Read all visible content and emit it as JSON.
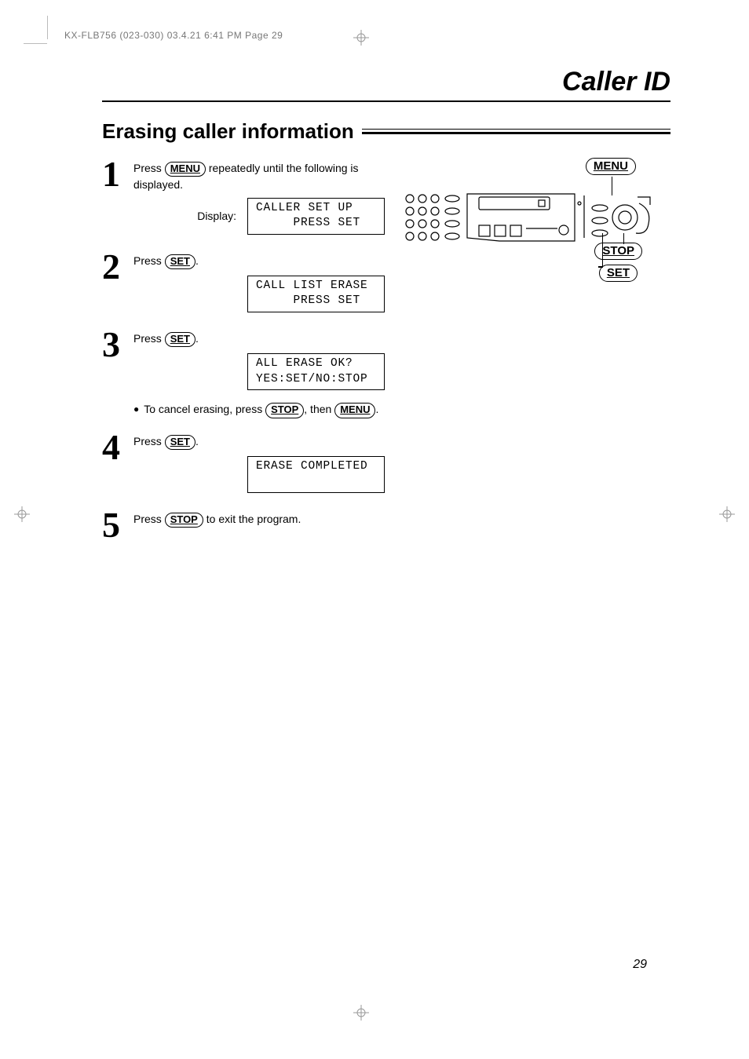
{
  "slug": "KX-FLB756 (023-030)  03.4.21  6:41 PM  Page 29",
  "chapter": "Caller ID",
  "section": "Erasing caller information",
  "keys": {
    "menu": "MENU",
    "set": "SET",
    "stop": "STOP"
  },
  "steps": {
    "s1": {
      "num": "1",
      "text_a": "Press ",
      "text_b": " repeatedly until the following is displayed.",
      "display_label": "Display:",
      "lcd": "CALLER SET UP\n     PRESS SET"
    },
    "s2": {
      "num": "2",
      "text_a": "Press ",
      "text_b": ".",
      "lcd": "CALL LIST ERASE\n     PRESS SET"
    },
    "s3": {
      "num": "3",
      "text_a": "Press ",
      "text_b": ".",
      "lcd": "ALL ERASE OK?\nYES:SET/NO:STOP",
      "bullet_a": "To cancel erasing, press ",
      "bullet_b": ", then ",
      "bullet_c": "."
    },
    "s4": {
      "num": "4",
      "text_a": "Press ",
      "text_b": ".",
      "lcd": "ERASE COMPLETED\n "
    },
    "s5": {
      "num": "5",
      "text_a": "Press ",
      "text_b": " to exit the program."
    }
  },
  "callouts": {
    "menu": "MENU",
    "stop": "STOP",
    "set": "SET"
  },
  "page_number": "29"
}
